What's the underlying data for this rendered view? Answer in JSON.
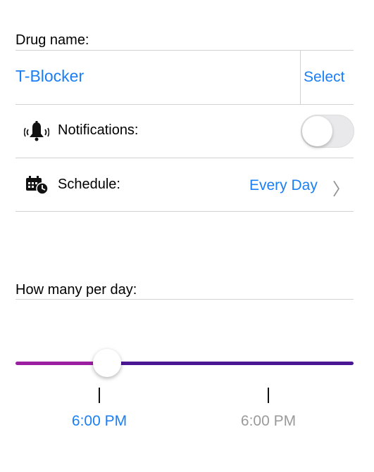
{
  "drug": {
    "label": "Drug name:",
    "value": "T-Blocker",
    "select_label": "Select"
  },
  "notifications": {
    "icon": "bell-icon",
    "label": "Notifications:",
    "enabled": false
  },
  "schedule": {
    "icon": "calendar-clock-icon",
    "label": "Schedule:",
    "value": "Every Day",
    "chevron": "〉"
  },
  "per_day": {
    "label": "How many per day:",
    "slider_value": 0.27
  },
  "times": [
    {
      "label": "6:00 PM",
      "active": true
    },
    {
      "label": "6:00 PM",
      "active": false
    }
  ],
  "colors": {
    "accent": "#1a7ef5",
    "slider_left": "#9b1fa0",
    "slider_right": "#4a1693",
    "inactive_time": "#9a9a9a"
  }
}
